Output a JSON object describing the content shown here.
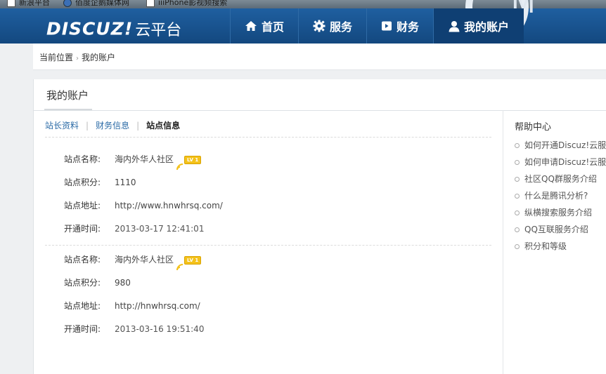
{
  "bookmarks": [
    {
      "label": "新浪平台",
      "icon": "page-icon"
    },
    {
      "label": "佰度企鹅媒体网",
      "icon": "globe-icon"
    },
    {
      "label": "iiiPhone影视频搜索",
      "icon": "page-icon"
    }
  ],
  "header": {
    "brand": "DISCUZ!",
    "subtitle": "云平台",
    "nav": [
      {
        "label": "首页",
        "icon": "home-icon"
      },
      {
        "label": "服务",
        "icon": "gear-icon"
      },
      {
        "label": "财务",
        "icon": "wallet-icon"
      },
      {
        "label": "我的账户",
        "icon": "user-icon",
        "active": true
      }
    ],
    "colors": {
      "bar": "#1b5896",
      "active": "#0f3f73"
    }
  },
  "breadcrumb": {
    "prefix": "当前位置",
    "current": "我的账户"
  },
  "page": {
    "title": "我的账户"
  },
  "tabs": {
    "profile": "站长资料",
    "finance": "财务信息",
    "site": "站点信息"
  },
  "sites": [
    {
      "name_label": "站点名称:",
      "name": "海内外华人社区",
      "level": "LV 1",
      "points_label": "站点积分:",
      "points": "1110",
      "url_label": "站点地址:",
      "url": "http://www.hnwhrsq.com/",
      "time_label": "开通时间:",
      "time": "2013-03-17 12:41:01"
    },
    {
      "name_label": "站点名称:",
      "name": "海内外华人社区",
      "level": "LV 1",
      "points_label": "站点积分:",
      "points": "980",
      "url_label": "站点地址:",
      "url": "http://hnwhrsq.com/",
      "time_label": "开通时间:",
      "time": "2013-03-16 19:51:40"
    }
  ],
  "help": {
    "title": "帮助中心",
    "items": [
      "如何开通Discuz!云服务",
      "如何申请Discuz!云服务",
      "社区QQ群服务介绍",
      "什么是腾讯分析?",
      "纵横搜索服务介绍",
      "QQ互联服务介绍",
      "积分和等级"
    ]
  }
}
